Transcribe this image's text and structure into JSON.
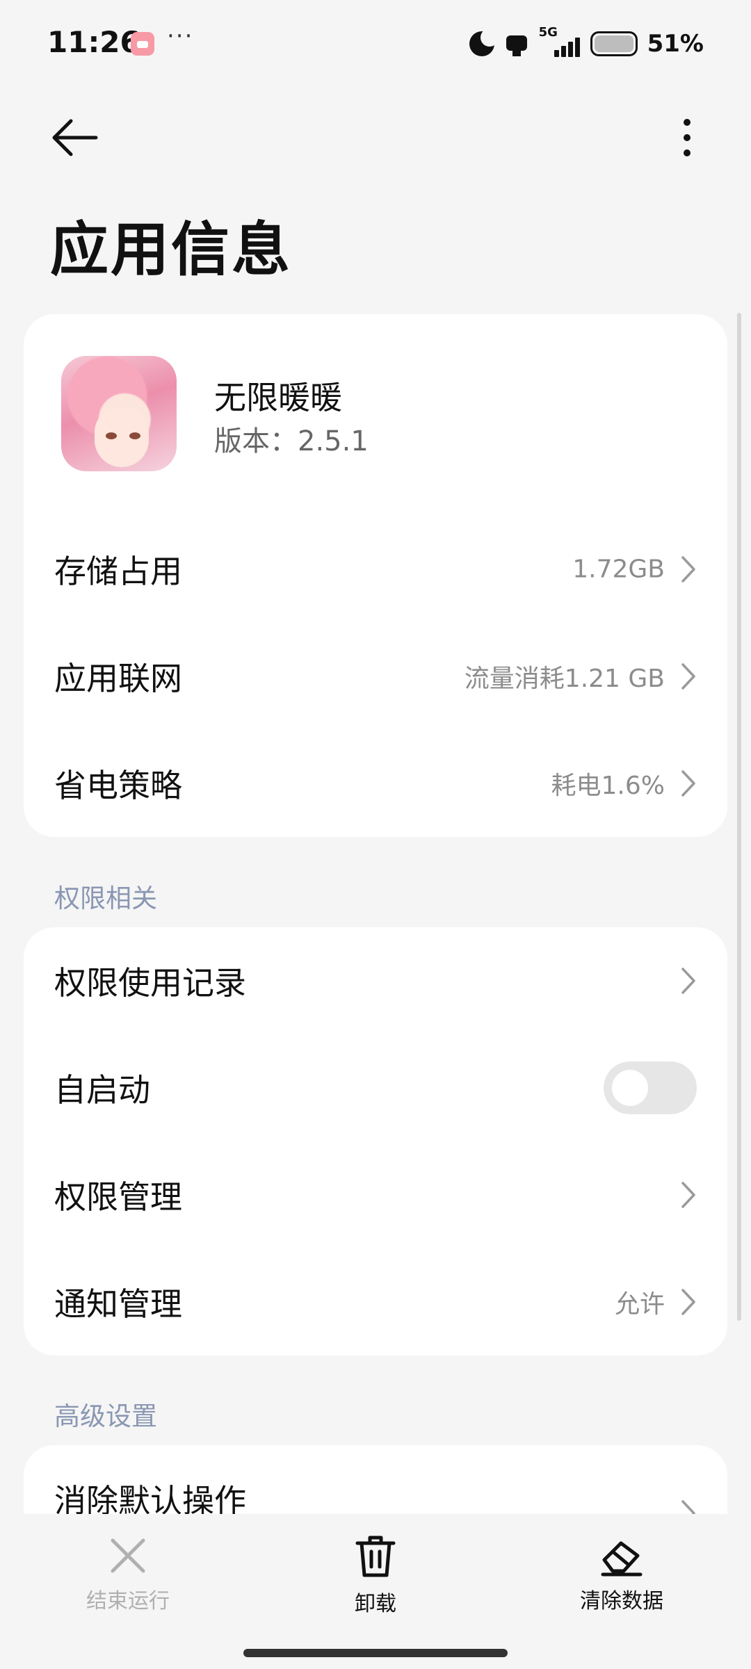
{
  "status_bar": {
    "time": "11:26",
    "more": "···",
    "network_label": "5G",
    "battery_percent": "51%",
    "icons": [
      "app-notification-icon",
      "moon-icon",
      "device-icon",
      "signal-icon",
      "battery-icon"
    ]
  },
  "header": {
    "title": "应用信息",
    "back_icon": "arrow-left-icon",
    "menu_icon": "more-vertical-icon"
  },
  "app": {
    "name": "无限暖暖",
    "version": "版本：2.5.1"
  },
  "info_rows": [
    {
      "label": "存储占用",
      "value": "1.72GB"
    },
    {
      "label": "应用联网",
      "value": "流量消耗1.21 GB"
    },
    {
      "label": "省电策略",
      "value": "耗电1.6%"
    }
  ],
  "permissions": {
    "section_title": "权限相关",
    "rows": [
      {
        "label": "权限使用记录",
        "value": ""
      },
      {
        "label": "自启动",
        "toggle_on": false
      },
      {
        "label": "权限管理",
        "value": ""
      },
      {
        "label": "通知管理",
        "value": "允许"
      }
    ]
  },
  "advanced": {
    "section_title": "高级设置",
    "rows": [
      {
        "label": "消除默认操作"
      }
    ]
  },
  "actions": [
    {
      "label": "结束运行",
      "icon": "close-icon",
      "enabled": false
    },
    {
      "label": "卸载",
      "icon": "trash-icon",
      "enabled": true
    },
    {
      "label": "清除数据",
      "icon": "eraser-icon",
      "enabled": true
    }
  ],
  "colors": {
    "background": "#f5f5f5",
    "card": "#ffffff",
    "section_label": "#8a97b3",
    "secondary_text": "#8c8c8c"
  }
}
